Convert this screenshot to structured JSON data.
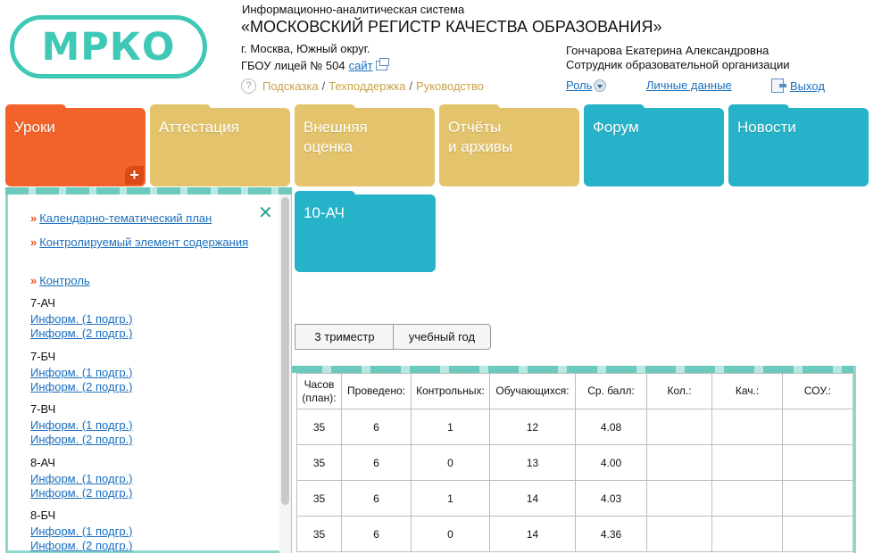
{
  "header": {
    "logo_text": "МРКО",
    "system_subtitle": "Информационно-аналитическая система",
    "system_title": "«МОСКОВСКИЙ РЕГИСТР КАЧЕСТВА ОБРАЗОВАНИЯ»",
    "location": "г. Москва, Южный округ.",
    "school": "ГБОУ лицей № 504",
    "site_link": "сайт",
    "help_link": "Подсказка",
    "support_link": "Техподдержка",
    "guide_link": "Руководство",
    "separator": "/",
    "help_icon": "?",
    "user_name": "Гончарова Екатерина Александровна",
    "user_role": "Сотрудник образовательной организации",
    "role_link": "Роль",
    "personal_data_link": "Личные данные",
    "exit_link": "Выход"
  },
  "tabs": [
    {
      "label_line1": "Уроки",
      "label_line2": ""
    },
    {
      "label_line1": "Аттестация",
      "label_line2": ""
    },
    {
      "label_line1": "Внешняя",
      "label_line2": "оценка"
    },
    {
      "label_line1": "Отчёты",
      "label_line2": "и архивы"
    },
    {
      "label_line1": "Форум",
      "label_line2": ""
    },
    {
      "label_line1": "Новости",
      "label_line2": ""
    }
  ],
  "tab_plus": "+",
  "class_tab": "10-АЧ",
  "dropdown": {
    "close": "✕",
    "bullet": "»",
    "menu": [
      {
        "label": "Календарно-тематический план"
      },
      {
        "label": "Контролируемый элемент содержания"
      },
      {
        "label": "Контроль"
      }
    ],
    "groups": [
      {
        "name": "7-АЧ",
        "links": [
          "Информ. (1 подгр.)",
          "Информ. (2 подгр.)"
        ]
      },
      {
        "name": "7-БЧ",
        "links": [
          "Информ. (1 подгр.)",
          "Информ. (2 подгр.)"
        ]
      },
      {
        "name": "7-ВЧ",
        "links": [
          "Информ. (1 подгр.)",
          "Информ. (2 подгр.)"
        ]
      },
      {
        "name": "8-АЧ",
        "links": [
          "Информ. (1 подгр.)",
          "Информ. (2 подгр.)"
        ]
      },
      {
        "name": "8-БЧ",
        "links": [
          "Информ. (1 подгр.)",
          "Информ. (2 подгр.)"
        ]
      }
    ]
  },
  "periods": [
    "3 триместр",
    "учебный год"
  ],
  "table": {
    "headers": [
      "Часов (план):",
      "Проведено:",
      "Контрольных:",
      "Обучающихся:",
      "Ср. балл:",
      "Кол.:",
      "Кач.:",
      "СОУ.:"
    ],
    "rows": [
      [
        "35",
        "6",
        "1",
        "12",
        "4.08",
        "",
        "",
        ""
      ],
      [
        "35",
        "6",
        "0",
        "13",
        "4.00",
        "",
        "",
        ""
      ],
      [
        "35",
        "6",
        "1",
        "14",
        "4.03",
        "",
        "",
        ""
      ],
      [
        "35",
        "6",
        "0",
        "14",
        "4.36",
        "",
        "",
        ""
      ]
    ]
  },
  "colors": {
    "brand_teal": "#3fc8b5",
    "tab_orange": "#f2622a",
    "tab_yellow": "#e3c46c",
    "tab_teal": "#26b2c8",
    "link_blue": "#1a6fbf"
  }
}
